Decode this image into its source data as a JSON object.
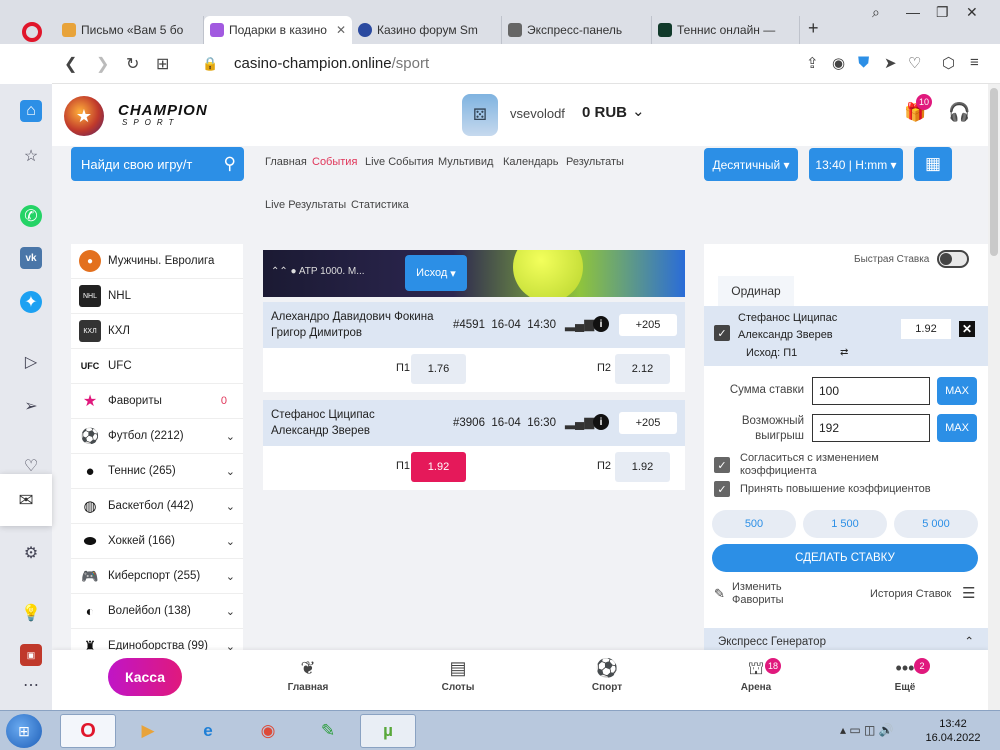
{
  "browser": {
    "tabs": [
      {
        "title": "Письмо «Вам 5 бо",
        "color": "#e8a33a"
      },
      {
        "title": "Подарки в казино",
        "color": "#a25ae0"
      },
      {
        "title": "Казино форум Sm",
        "color": "#2b4aa0"
      },
      {
        "title": "Экспресс-панель",
        "color": "#666666"
      },
      {
        "title": "Теннис онлайн —",
        "color": "#123a2b"
      }
    ],
    "url_host": "casino-champion.online",
    "url_path": "/sport"
  },
  "header": {
    "logo_title": "CHAMPION",
    "logo_subtitle": "SPORT",
    "username": "vsevolodf",
    "balance": "0 RUB",
    "gift_badge": "10"
  },
  "search": {
    "label": "Найди свою игру/т"
  },
  "topnav": {
    "items": [
      "Главная",
      "События",
      "Live События",
      "Мультивид",
      "Календарь",
      "Результаты",
      "Live Результаты",
      "Статистика"
    ]
  },
  "selectors": {
    "odds_format": "Десятичный",
    "time_format": "13:40 | H:mm"
  },
  "sports": [
    {
      "label": "Мужчины. Евролига"
    },
    {
      "label": "NHL"
    },
    {
      "label": "КХЛ"
    },
    {
      "label": "UFC"
    },
    {
      "label": "Фавориты",
      "count": "0"
    },
    {
      "label": "Футбол (2212)"
    },
    {
      "label": "Теннис (265)"
    },
    {
      "label": "Баскетбол (442)"
    },
    {
      "label": "Хоккей (166)"
    },
    {
      "label": "Киберспорт (255)"
    },
    {
      "label": "Волейбол (138)"
    },
    {
      "label": "Единоборства (99)"
    }
  ],
  "banner": {
    "text": "ATP 1000. M...",
    "outcome_btn": "Исход"
  },
  "matches": [
    {
      "team1": "Алехандро Давидович Фокина",
      "team2": "Григор Димитров",
      "id": "#4591",
      "date": "16-04",
      "time": "14:30",
      "more": "+205",
      "p1_label": "П1",
      "p1": "1.76",
      "p2_label": "П2",
      "p2": "2.12"
    },
    {
      "team1": "Стефанос Циципас",
      "team2": "Александр Зверев",
      "id": "#3906",
      "date": "16-04",
      "time": "16:30",
      "more": "+205",
      "p1_label": "П1",
      "p1": "1.92",
      "p2_label": "П2",
      "p2": "1.92"
    }
  ],
  "betslip": {
    "quick_bet": "Быстрая Ставка",
    "tab": "Ординар",
    "bet_team1": "Стефанос Циципас",
    "bet_team2": "Александр Зверев",
    "bet_outcome": "Исход: П1",
    "bet_odd": "1.92",
    "stake_label": "Сумма ставки",
    "stake_value": "100",
    "win_label_1": "Возможный",
    "win_label_2": "выигрыш",
    "win_value": "192",
    "max": "MAX",
    "agree_change_1": "Согласиться с изменением",
    "agree_change_2": "коэффициента",
    "accept_raise": "Принять повышение коэффициентов",
    "amounts": [
      "500",
      "1 500",
      "5 000"
    ],
    "make_bet": "СДЕЛАТЬ СТАВКУ",
    "change_fav_1": "Изменить",
    "change_fav_2": "Фавориты",
    "history": "История Ставок",
    "express": "Экспресс Генератор"
  },
  "bottom_nav": {
    "kassa": "Касса",
    "items": [
      {
        "label": "Главная"
      },
      {
        "label": "Слоты"
      },
      {
        "label": "Спорт"
      },
      {
        "label": "Арена",
        "badge": "18"
      },
      {
        "label": "Ещё",
        "badge": "2"
      }
    ]
  },
  "taskbar": {
    "time": "13:42",
    "date": "16.04.2022"
  }
}
